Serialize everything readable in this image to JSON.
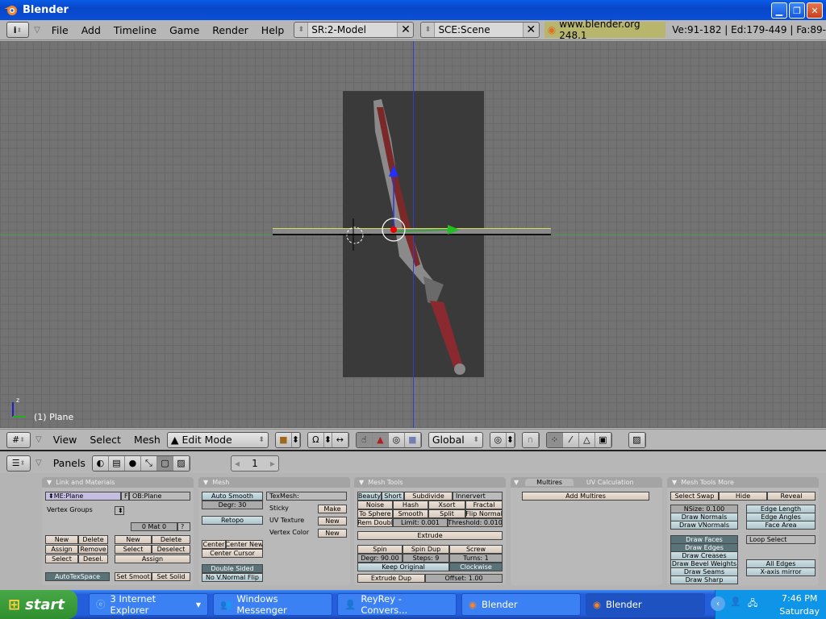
{
  "window": {
    "title": "Blender"
  },
  "menubar": {
    "items": [
      "File",
      "Add",
      "Timeline",
      "Game",
      "Render",
      "Help"
    ],
    "screen_field": "SR:2-Model",
    "scene_field": "SCE:Scene",
    "version": "www.blender.org 248.1",
    "stats": "Ve:91-182 | Ed:179-449 | Fa:89-"
  },
  "viewport": {
    "object_label": "(1) Plane",
    "axis_z": "z"
  },
  "view3d_header": {
    "menus": [
      "View",
      "Select",
      "Mesh"
    ],
    "mode": "Edit Mode",
    "orientation": "Global"
  },
  "buttons_header": {
    "menu": "Panels",
    "page": "1"
  },
  "panels": {
    "link_materials": {
      "title": "Link and Materials",
      "mesh_name": "ME:Plane",
      "f": "F",
      "ob_name": "OB:Plane",
      "vertex_groups": "Vertex Groups",
      "mat": "0 Mat 0",
      "q": "?",
      "left_buttons": [
        "New",
        "Delete",
        "Assign",
        "Remove",
        "Select",
        "Desel."
      ],
      "right_buttons": [
        "New",
        "Delete",
        "Select",
        "Deselect",
        "Assign"
      ],
      "autotex": "AutoTexSpace",
      "set_smooth": "Set Smoot",
      "set_solid": "Set Solid"
    },
    "mesh": {
      "title": "Mesh",
      "auto_smooth": "Auto Smooth",
      "degr": "Degr: 30",
      "retopo": "Retopo",
      "texmesh": "TexMesh:",
      "sticky": "Sticky",
      "make": "Make",
      "uv_texture": "UV Texture",
      "new1": "New",
      "vertex_color": "Vertex Color",
      "new2": "New",
      "center": "Center",
      "center_new": "Center New",
      "center_cursor": "Center Cursor",
      "double_sided": "Double Sided",
      "no_vnormal": "No V.Normal Flip"
    },
    "mesh_tools": {
      "title": "Mesh Tools",
      "row1": [
        "Beauty",
        "Short",
        "Subdivide",
        "Innervert"
      ],
      "row2": [
        "Noise",
        "Hash",
        "Xsort",
        "Fractal"
      ],
      "row3": [
        "To Sphere",
        "Smooth",
        "Split",
        "Flip Normal"
      ],
      "row4": [
        "Rem Doubl",
        "Limit: 0.001",
        "Threshold: 0.010"
      ],
      "extrude": "Extrude",
      "row5": [
        "Spin",
        "Spin Dup",
        "Screw"
      ],
      "row6": [
        "Degr: 90.00",
        "Steps: 9",
        "Turns: 1"
      ],
      "keep_original": "Keep Original",
      "clockwise": "Clockwise",
      "extrude_dup": "Extrude Dup",
      "offset": "Offset: 1.00"
    },
    "multires": {
      "tab1": "Multires",
      "tab2": "UV Calculation",
      "add": "Add Multires"
    },
    "mesh_tools_more": {
      "title": "Mesh Tools More",
      "row1": [
        "Select Swap",
        "Hide",
        "Reveal"
      ],
      "left": [
        "NSize: 0.100",
        "Draw Normals",
        "Draw VNormals"
      ],
      "right": [
        "Edge Length",
        "Edge Angles",
        "Face Area"
      ],
      "draw": [
        "Draw Faces",
        "Draw Edges",
        "Draw Creases",
        "Draw Bevel Weights",
        "Draw Seams",
        "Draw Sharp"
      ],
      "loop_select": "Loop Select",
      "all_edges": "All Edges",
      "xmirror": "X-axis mirror"
    }
  },
  "taskbar": {
    "start": "start",
    "tasks": [
      "3 Internet Explorer",
      "Windows Messenger",
      "ReyRey - Convers...",
      "Blender",
      "Blender"
    ],
    "time": "7:46 PM",
    "day": "Saturday"
  }
}
